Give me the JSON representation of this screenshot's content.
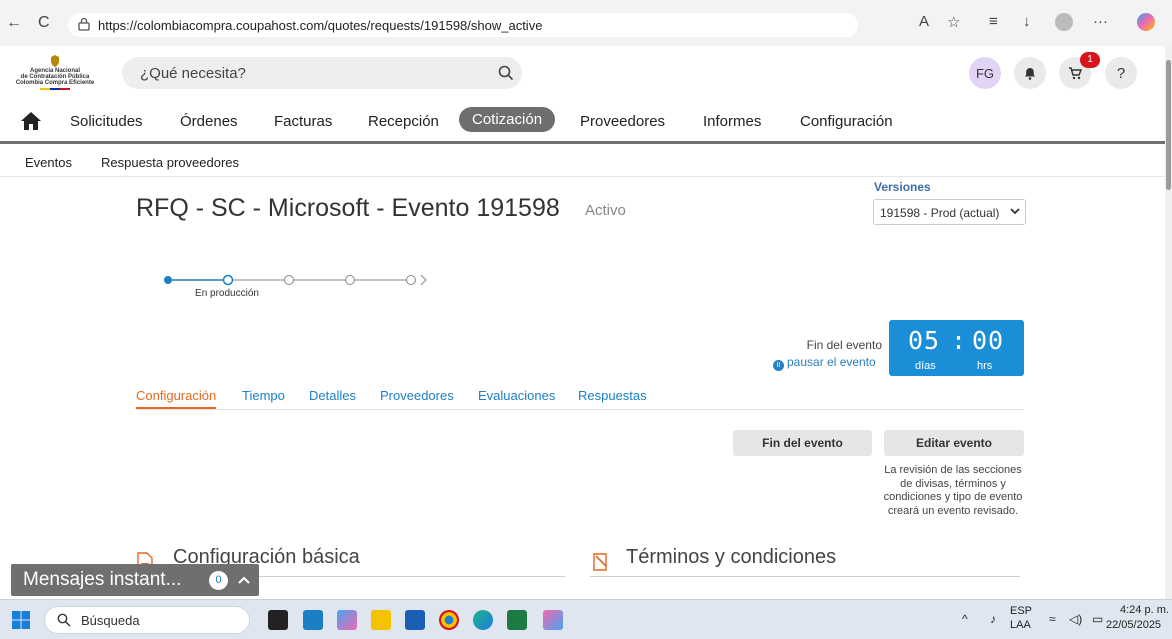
{
  "browser": {
    "url": "https://colombiacompra.coupahost.com/quotes/requests/191598/show_active",
    "back_glyph": "←",
    "reload_glyph": "C"
  },
  "header": {
    "logo_line1": "Agencia Nacional",
    "logo_line2": "de Contratación Pública",
    "logo_line3": "Colombia Compra Eficiente",
    "search_placeholder": "¿Qué necesita?",
    "avatar_initials": "FG",
    "cart_count": "1",
    "help_label": "?"
  },
  "main_nav": {
    "items": [
      "Solicitudes",
      "Órdenes",
      "Facturas",
      "Recepción",
      "Cotización",
      "Proveedores",
      "Informes",
      "Configuración"
    ],
    "active": "Cotización"
  },
  "sub_nav": {
    "items": [
      "Eventos",
      "Respuesta proveedores"
    ]
  },
  "event": {
    "title": "RFQ - SC - Microsoft - Evento 191598",
    "status": "Activo",
    "versions_label": "Versiones",
    "version_selected": "191598 - Prod (actual)",
    "step_label": "En producción",
    "end_label": "Fin del evento",
    "pause_link": "pausar el evento",
    "countdown_days": "05",
    "countdown_separator": ":",
    "countdown_hours": "00",
    "days_unit": "días",
    "hours_unit": "hrs"
  },
  "tabs": {
    "items": [
      "Configuración",
      "Tiempo",
      "Detalles",
      "Proveedores",
      "Evaluaciones",
      "Respuestas"
    ],
    "active": "Configuración"
  },
  "actions": {
    "end_event": "Fin del evento",
    "edit_event": "Editar evento",
    "edit_note": "La revisión de las secciones de divisas, términos y condiciones y tipo de evento creará un evento revisado."
  },
  "sections": {
    "basic_config": "Configuración básica",
    "terms": "Términos y condiciones"
  },
  "messenger": {
    "label": "Mensajes instant...",
    "count": "0"
  },
  "taskbar": {
    "search_label": "Búsqueda",
    "lang_line1": "ESP",
    "lang_line2": "LAA",
    "time": "4:24 p. m.",
    "date": "22/05/2025"
  },
  "colors": {
    "accent_orange": "#e8671e",
    "link_blue": "#1a7fc4",
    "countdown_blue": "#1a8fd8",
    "nav_active": "#6e6e6e"
  }
}
